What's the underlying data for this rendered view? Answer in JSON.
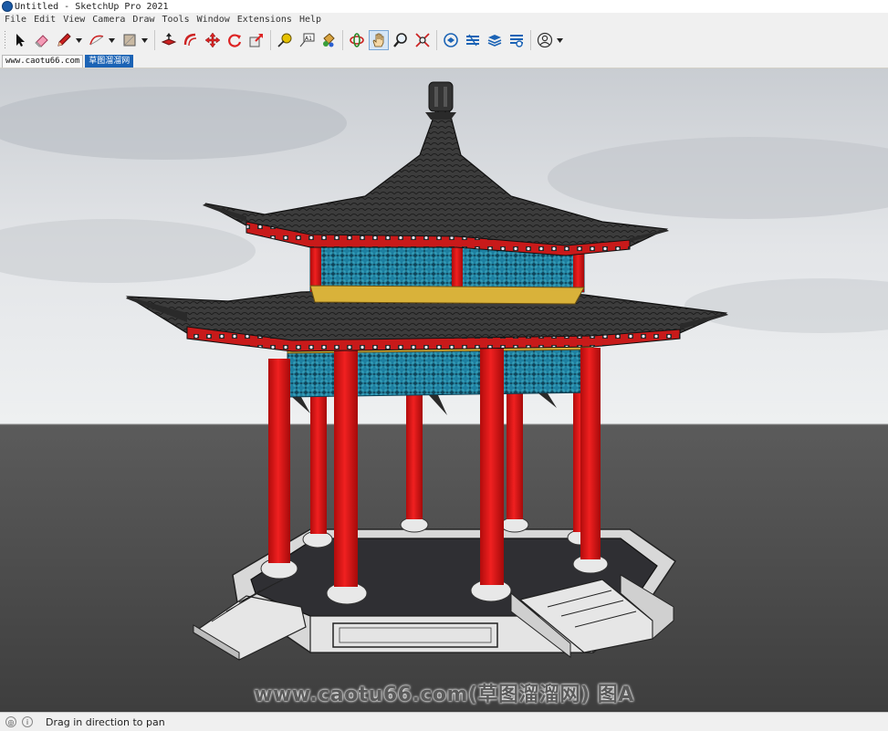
{
  "window": {
    "title": "Untitled - SketchUp Pro 2021"
  },
  "menu": [
    "File",
    "Edit",
    "View",
    "Camera",
    "Draw",
    "Tools",
    "Window",
    "Extensions",
    "Help"
  ],
  "toolbar": {
    "tools": [
      {
        "name": "select-tool",
        "icon": "arrow-cursor-icon"
      },
      {
        "name": "eraser-tool",
        "icon": "eraser-icon"
      },
      {
        "name": "line-tool",
        "icon": "pencil-icon"
      },
      {
        "name": "arc-tool",
        "icon": "arc-icon"
      },
      {
        "name": "rectangle-tool",
        "icon": "rectangle-icon"
      },
      {
        "name": "push-pull-tool",
        "icon": "push-pull-icon"
      },
      {
        "name": "offset-tool",
        "icon": "offset-icon"
      },
      {
        "name": "move-tool",
        "icon": "move-icon"
      },
      {
        "name": "rotate-tool",
        "icon": "rotate-icon"
      },
      {
        "name": "scale-tool",
        "icon": "scale-icon"
      },
      {
        "name": "tape-measure-tool",
        "icon": "tape-measure-icon"
      },
      {
        "name": "text-tool",
        "icon": "text-icon",
        "label": "A1"
      },
      {
        "name": "paint-bucket-tool",
        "icon": "paint-bucket-icon"
      },
      {
        "name": "orbit-tool",
        "icon": "orbit-icon"
      },
      {
        "name": "pan-tool",
        "icon": "hand-icon",
        "selected": true
      },
      {
        "name": "zoom-tool",
        "icon": "magnifier-icon"
      },
      {
        "name": "zoom-extents-tool",
        "icon": "zoom-extents-icon"
      },
      {
        "name": "warehouse-tool",
        "icon": "3d-warehouse-icon"
      },
      {
        "name": "extension-warehouse-tool",
        "icon": "extension-warehouse-icon"
      },
      {
        "name": "layout-tool",
        "icon": "layout-icon"
      },
      {
        "name": "extension-manager-tool",
        "icon": "extension-manager-icon"
      },
      {
        "name": "account-tool",
        "icon": "user-account-icon"
      }
    ]
  },
  "tabs": [
    {
      "label": "www.caotu66.com",
      "active": false
    },
    {
      "label": "草图溜溜网",
      "active": true
    }
  ],
  "viewport": {
    "watermark": "www.caotu66.com(草图溜溜网) 图A",
    "sky_color": "#e6e8ea",
    "ground_color": "#4a4a4a",
    "column_color": "#e01515",
    "roof_color": "#3a3a3a",
    "lattice_color": "#1a7c96"
  },
  "status": {
    "text": "Drag in direction to pan"
  }
}
